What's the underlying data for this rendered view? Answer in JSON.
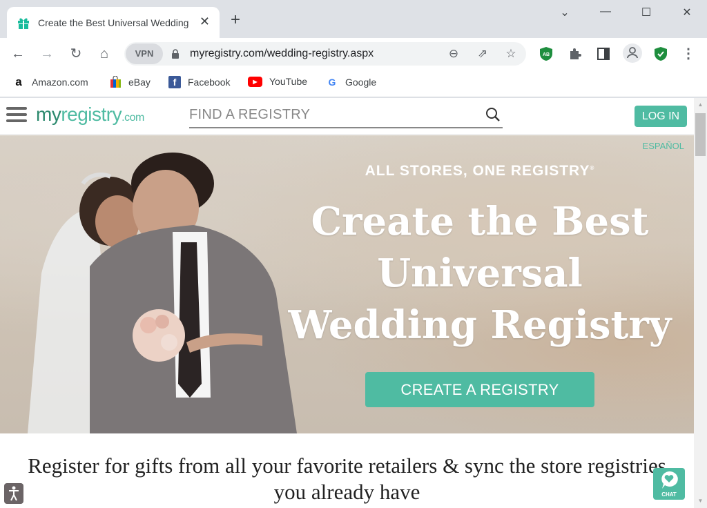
{
  "browser": {
    "tab": {
      "title": "Create the Best Universal Wedding Registry",
      "favicon": "gift-icon",
      "favicon_color": "#1abc9c"
    },
    "window_controls": [
      "chevron-down-icon",
      "minimize-icon",
      "maximize-icon",
      "close-icon"
    ],
    "toolbar": {
      "vpn_label": "VPN",
      "url": "myregistry.com/wedding-registry.aspx",
      "extensions": [
        "adblock-icon",
        "puzzle-icon",
        "sidepanel-icon",
        "profile-icon",
        "shield-check-icon",
        "more-icon"
      ]
    },
    "bookmarks": [
      {
        "label": "Amazon.com",
        "icon": "amazon-icon"
      },
      {
        "label": "eBay",
        "icon": "ebay-icon"
      },
      {
        "label": "Facebook",
        "icon": "facebook-icon"
      },
      {
        "label": "YouTube",
        "icon": "youtube-icon"
      },
      {
        "label": "Google",
        "icon": "google-icon"
      }
    ]
  },
  "site": {
    "logo": {
      "my": "my",
      "registry": "registry",
      "com": ".com"
    },
    "search": {
      "placeholder": "FIND A REGISTRY",
      "value": ""
    },
    "login_label": "LOG IN",
    "language_link": "ESPAÑOL",
    "hero": {
      "tagline": "ALL STORES, ONE REGISTRY",
      "tagline_mark": "®",
      "headline": "Create the Best Universal Wedding Registry",
      "cta_label": "CREATE A REGISTRY"
    },
    "subhead": "Register for gifts from all your favorite retailers & sync the store registries you already have",
    "chat_label": "CHAT",
    "accent_color": "#4fbba2"
  }
}
